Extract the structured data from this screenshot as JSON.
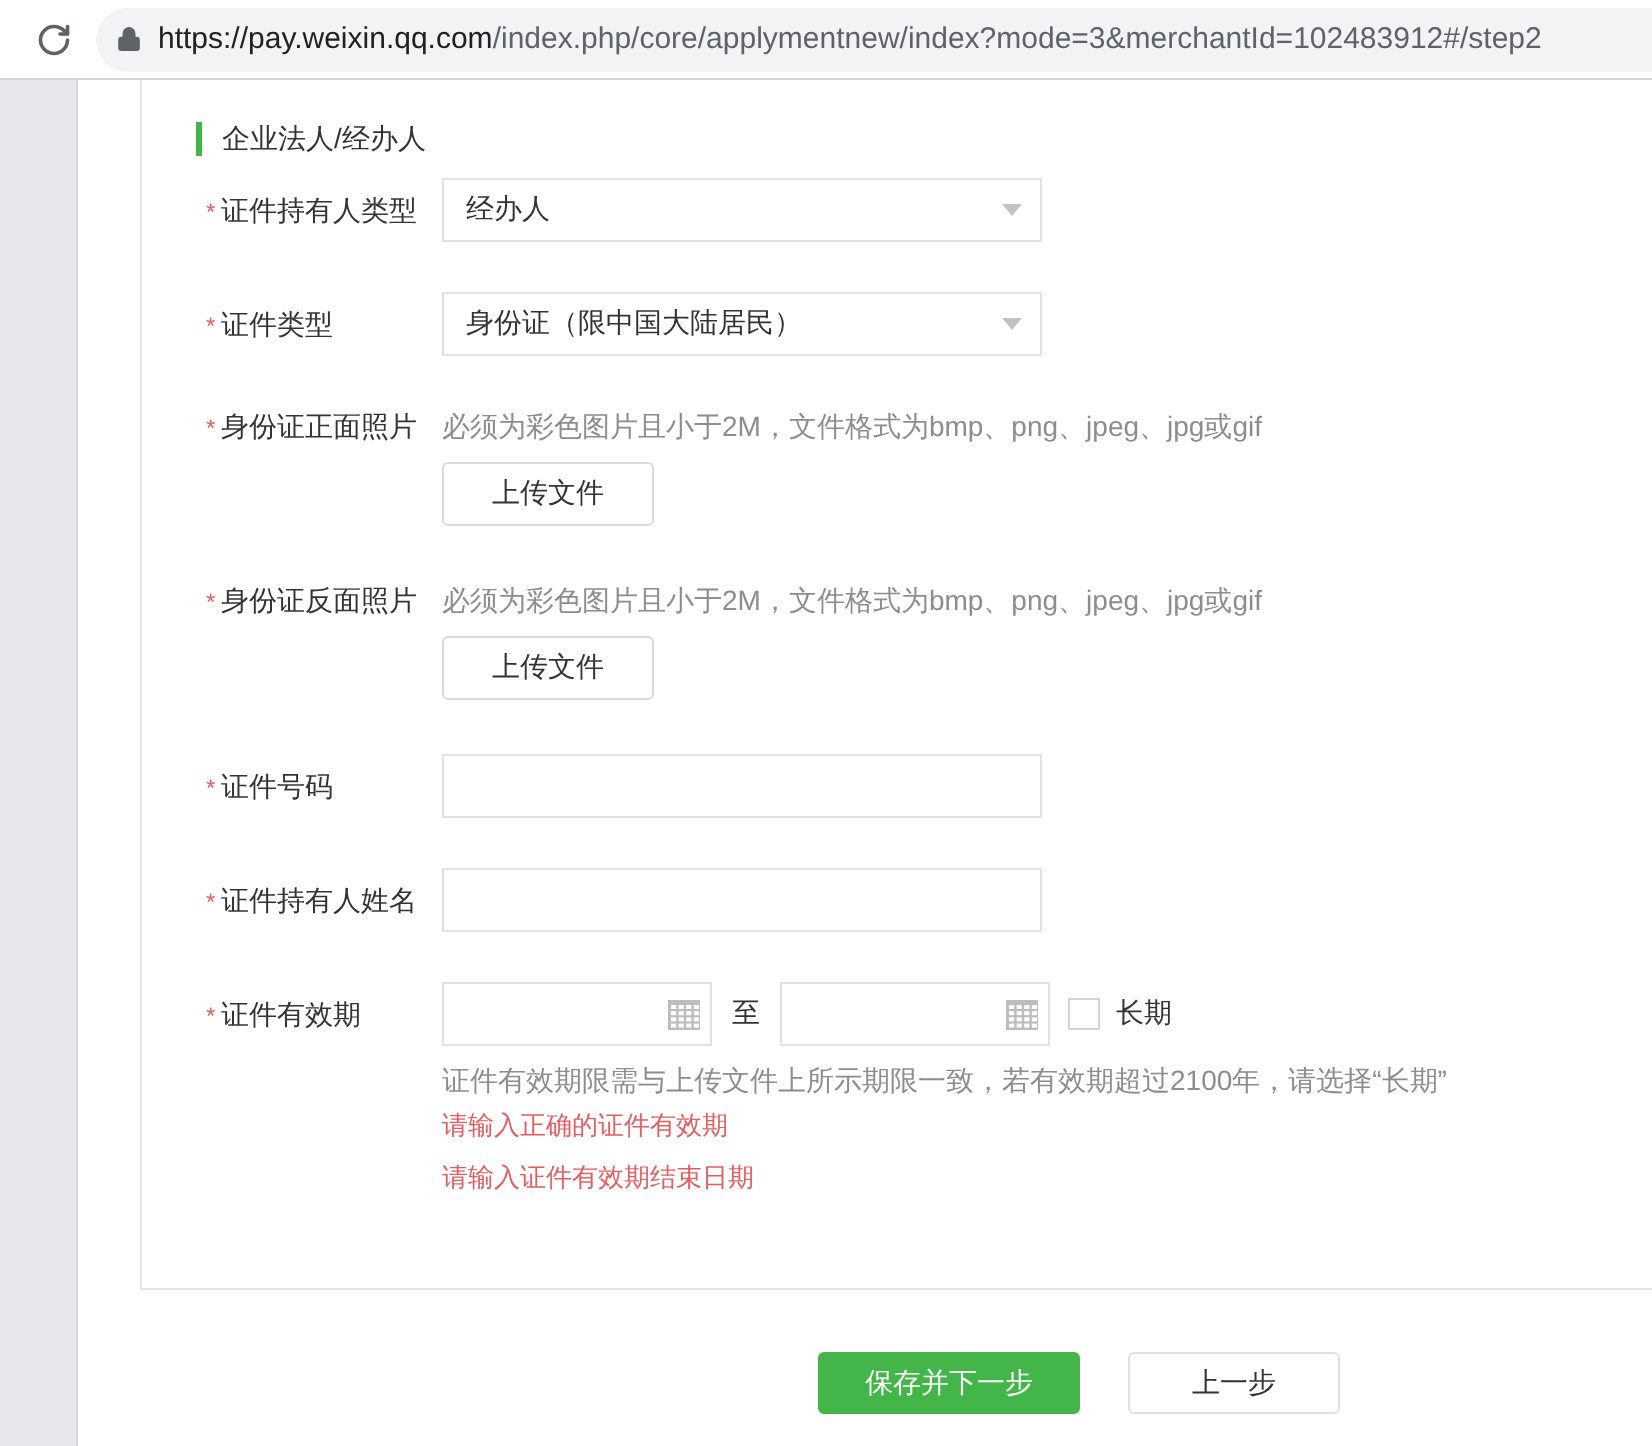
{
  "address_bar": {
    "host": "https://pay.weixin.qq.com",
    "path": "/index.php/core/applymentnew/index?mode=3&merchantId=102483912#/step2"
  },
  "section_title": "企业法人/经办人",
  "fields": [
    {
      "kind": "select",
      "label": "证件持有人类型",
      "mark": "*",
      "value": "经办人"
    },
    {
      "kind": "select",
      "label": "证件类型",
      "mark": "*",
      "value": "身份证（限中国大陆居民）"
    },
    {
      "kind": "upload",
      "label": "身份证正面照片",
      "mark": "*",
      "hint": "必须为彩色图片且小于2M，文件格式为bmp、png、jpeg、jpg或gif",
      "button": "上传文件"
    },
    {
      "kind": "upload",
      "label": "身份证反面照片",
      "mark": "*",
      "hint": "必须为彩色图片且小于2M，文件格式为bmp、png、jpeg、jpg或gif",
      "button": "上传文件"
    },
    {
      "kind": "text",
      "label": "证件号码",
      "mark": "*"
    },
    {
      "kind": "text",
      "label": "证件持有人姓名",
      "mark": "*"
    },
    {
      "kind": "date_range",
      "label": "证件有效期",
      "mark": "*",
      "separator": "至",
      "checkbox": {
        "label": "长期",
        "checked": false
      },
      "hint": "证件有效期限需与上传文件上所示期限一致，若有效期超过2100年，请选择“长期”",
      "errors": [
        "请输入正确的证件有效期",
        "请输入证件有效期结束日期"
      ]
    }
  ],
  "buttons": [
    {
      "label": "保存并下一步",
      "kind": "primary"
    },
    {
      "label": "上一步",
      "kind": "default"
    }
  ]
}
